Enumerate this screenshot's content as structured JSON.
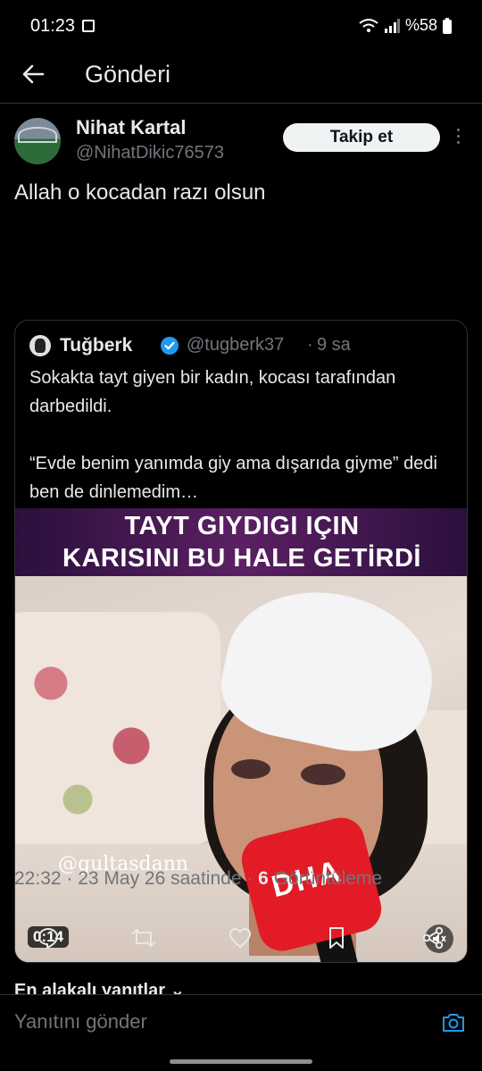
{
  "status_bar": {
    "time": "01:23",
    "battery": "%58"
  },
  "header": {
    "title": "Gönderi"
  },
  "post": {
    "author_name": "Nihat Kartal",
    "author_handle": "@NihatDikic76573",
    "follow_label": "Takip et",
    "text": "Allah o kocadan razı olsun",
    "timestamp": "22:32 · 23 May 26 saatinde · ",
    "views_count": "6",
    "views_label": " Görüntüleme"
  },
  "quote": {
    "author_name": "Tuğberk",
    "author_handle": "@tugberk37",
    "separator": "·",
    "time": "9 sa",
    "paragraph_1": "Sokakta tayt giyen bir kadın, kocası tarafından darbedildi.",
    "paragraph_2": "“Evde benim yanımda giy ama dışarıda giyme” dedi ben de dinlemedim…",
    "media": {
      "banner_line_1": "TAYT GIYDIGI IÇIN",
      "banner_line_2": "KARISINI BU HALE GETİRDİ",
      "watermark": "@gultasdann",
      "mic_logo": "DHA",
      "duration": "0:14"
    }
  },
  "replies": {
    "header": "En alakalı yanıtlar ⌄",
    "input_placeholder": "Yanıtını gönder"
  },
  "colors": {
    "background": "#000000",
    "text_primary": "#e7e9ea",
    "text_secondary": "#71767b",
    "accent": "#1d9bf0",
    "divider": "#2f3336"
  }
}
